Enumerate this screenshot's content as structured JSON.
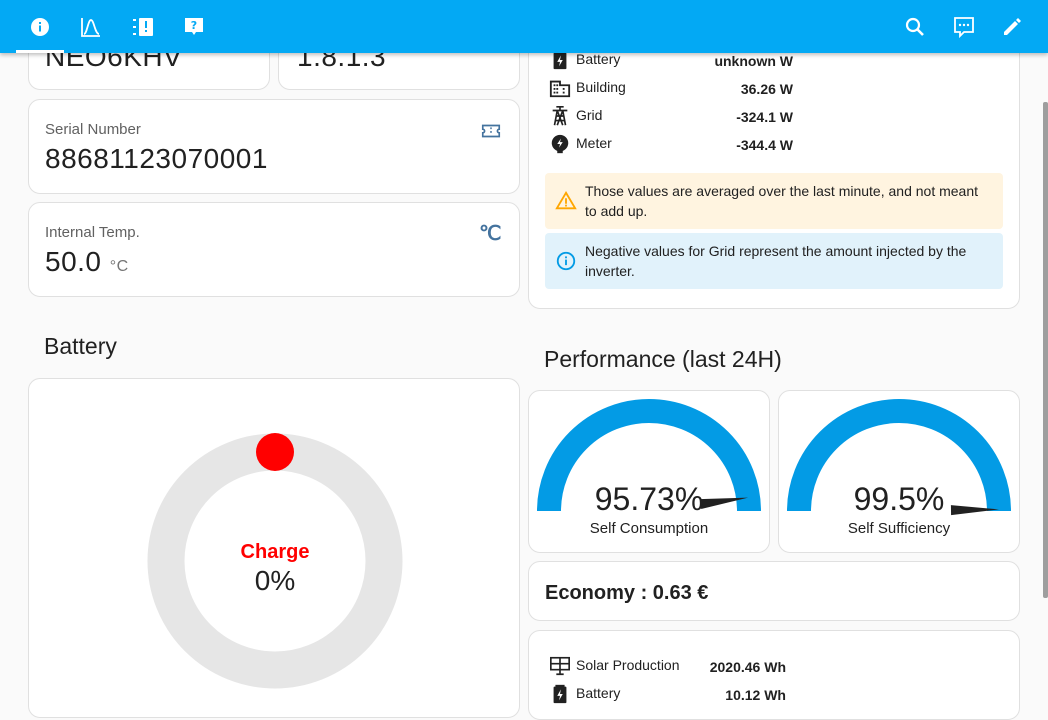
{
  "topbar": {
    "icons": [
      "info-icon",
      "chart-bell-curve-icon",
      "alert-list-icon",
      "help-message-icon",
      "search-icon",
      "assist-message-icon",
      "pencil-icon"
    ]
  },
  "device": {
    "model_partial": "NEO6KHV",
    "version_partial": "1.8.1.3",
    "serial_label": "Serial Number",
    "serial_value": "88681123070001",
    "temp_label": "Internal Temp.",
    "temp_value": "50.0",
    "temp_unit": "°C"
  },
  "power": {
    "rows": [
      {
        "label": "Battery",
        "value": "unknown W",
        "icon": "battery-charging-icon"
      },
      {
        "label": "Building",
        "value": "36.26 W",
        "icon": "office-building-icon"
      },
      {
        "label": "Grid",
        "value": "-324.1 W",
        "icon": "transmission-tower-icon"
      },
      {
        "label": "Meter",
        "value": "-344.4 W",
        "icon": "meter-electric-icon"
      }
    ],
    "warning": "Those values are averaged over the last minute, and not meant to add up.",
    "info": "Negative values for Grid represent the amount injected by the inverter."
  },
  "battery": {
    "title": "Battery",
    "charge_label": "Charge",
    "charge_value": "0%",
    "charge_percent": 0
  },
  "performance": {
    "title": "Performance (last 24H)",
    "gauges": [
      {
        "label": "Self Consumption",
        "value": "95.73%",
        "percent": 95.73
      },
      {
        "label": "Self Sufficiency",
        "value": "99.5%",
        "percent": 99.5
      }
    ],
    "economy_label": "Economy : ",
    "economy_value": "0.63 €"
  },
  "energy": {
    "rows": [
      {
        "label": "Solar Production",
        "value": "2020.46 Wh",
        "icon": "solar-panel-icon"
      },
      {
        "label": "Battery",
        "value": "10.12 Wh",
        "icon": "battery-charging-icon"
      }
    ]
  },
  "colors": {
    "topbar": "#03a9f4",
    "gauge": "#039be5",
    "charge_red": "#ff0000",
    "warning_bg": "#fff4e0",
    "info_bg": "#e1f2fb"
  }
}
